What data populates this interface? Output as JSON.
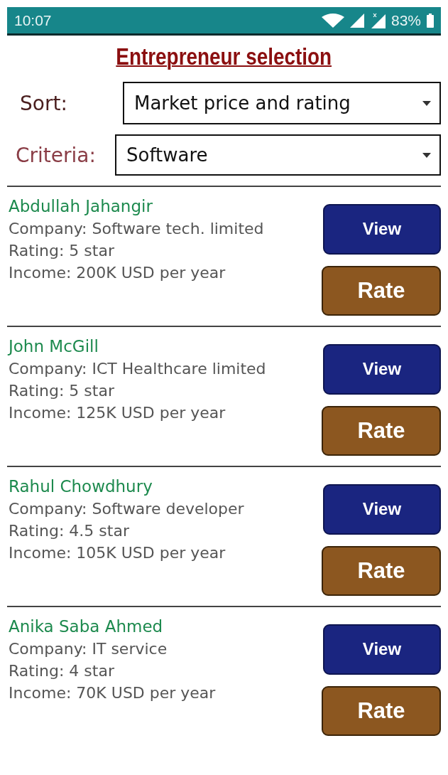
{
  "status_bar": {
    "time": "10:07",
    "battery": "83%"
  },
  "title": "Entrepreneur selection",
  "filters": [
    {
      "label": "Sort:",
      "value": "Market price and rating"
    },
    {
      "label": "Criteria:",
      "value": "Software"
    }
  ],
  "entrepreneurs": [
    {
      "name": "Abdullah Jahangir",
      "company": "Company:  Software tech. limited",
      "rating": "Rating: 5 star",
      "income": "Income: 200K USD per year",
      "buttons": [
        "View",
        "Rate"
      ]
    },
    {
      "name": "John McGill",
      "company": "Company:  ICT Healthcare limited",
      "rating": "Rating: 5 star",
      "income": "Income: 125K USD per year",
      "buttons": [
        "View",
        "Rate"
      ]
    },
    {
      "name": "Rahul Chowdhury",
      "company": "Company:  Software developer",
      "rating": "Rating: 4.5 star",
      "income": "Income: 105K USD per year",
      "buttons": [
        "View",
        "Rate"
      ]
    },
    {
      "name": "Anika Saba Ahmed",
      "company": "Company:  IT service",
      "rating": "Rating: 4 star",
      "income": "Income: 70K USD per year",
      "buttons": [
        "View",
        "Rate"
      ]
    }
  ]
}
